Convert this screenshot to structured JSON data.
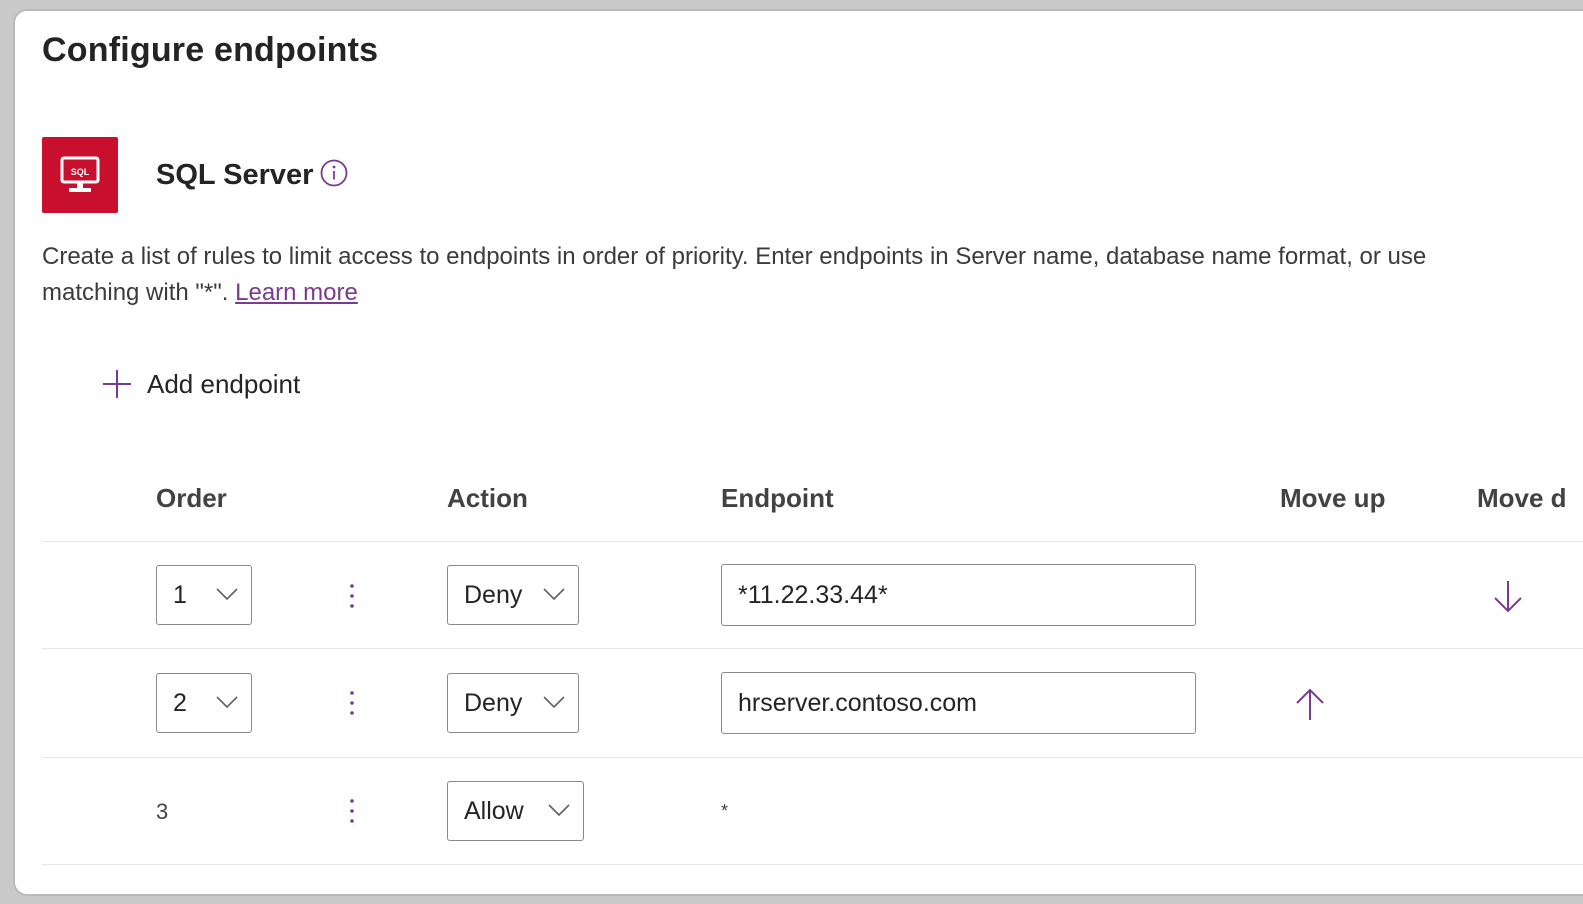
{
  "page": {
    "title": "Configure endpoints"
  },
  "connector": {
    "name": "SQL Server",
    "icon": "sql-server-icon",
    "icon_text": "SQL",
    "brand_color": "#c8102e"
  },
  "description": {
    "line1": "Create a list of rules to limit access to endpoints in order of priority. Enter endpoints in Server name, database name format, or use",
    "line2_prefix": "matching with \"*\". ",
    "learn_more": "Learn more"
  },
  "actions": {
    "add_endpoint": "Add endpoint"
  },
  "table": {
    "headers": {
      "order": "Order",
      "action": "Action",
      "endpoint": "Endpoint",
      "move_up": "Move up",
      "move_down": "Move d"
    },
    "rows": [
      {
        "order": "1",
        "action": "Deny",
        "endpoint": "*11.22.33.44*"
      },
      {
        "order": "2",
        "action": "Deny",
        "endpoint": "hrserver.contoso.com"
      },
      {
        "order": "3",
        "action": "Allow",
        "endpoint": "*"
      }
    ]
  },
  "colors": {
    "accent": "#7a3b8f",
    "text": "#242424"
  }
}
